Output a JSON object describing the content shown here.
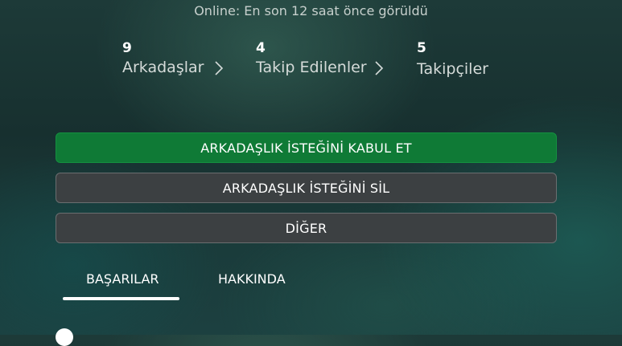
{
  "status_text": "Online: En son 12 saat önce görüldü",
  "stats": {
    "friends": {
      "count": "9",
      "label": "Arkadaşlar"
    },
    "following": {
      "count": "4",
      "label": "Takip Edilenler"
    },
    "followers": {
      "count": "5",
      "label": "Takipçiler"
    }
  },
  "buttons": {
    "accept": "ARKADAŞLIK İSTEĞİNİ KABUL ET",
    "delete": "ARKADAŞLIK İSTEĞİNİ SİL",
    "other": "DİĞER"
  },
  "tabs": [
    {
      "label": "BAŞARILAR",
      "selected": true
    },
    {
      "label": "HAKKINDA",
      "selected": false
    }
  ],
  "colors": {
    "accept_button": "#0f7a36",
    "secondary_button": "#3c4042"
  }
}
